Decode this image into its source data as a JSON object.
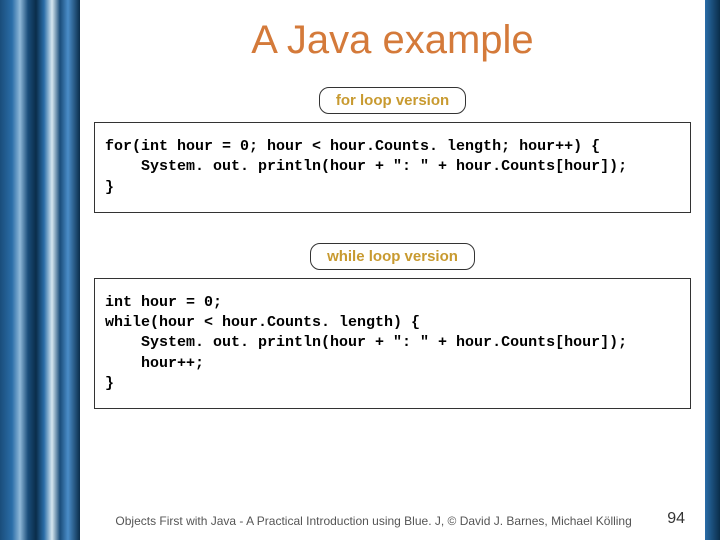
{
  "title": "A Java example",
  "section1": {
    "label": "for loop version",
    "code": "for(int hour = 0; hour < hour.Counts. length; hour++) {\n    System. out. println(hour + \": \" + hour.Counts[hour]);\n}"
  },
  "section2": {
    "label": "while loop version",
    "code": "int hour = 0;\nwhile(hour < hour.Counts. length) {\n    System. out. println(hour + \": \" + hour.Counts[hour]);\n    hour++;\n}"
  },
  "footer": {
    "citation": "Objects First with Java - A Practical Introduction using Blue. J, © David J. Barnes, Michael Kölling",
    "page": "94"
  }
}
